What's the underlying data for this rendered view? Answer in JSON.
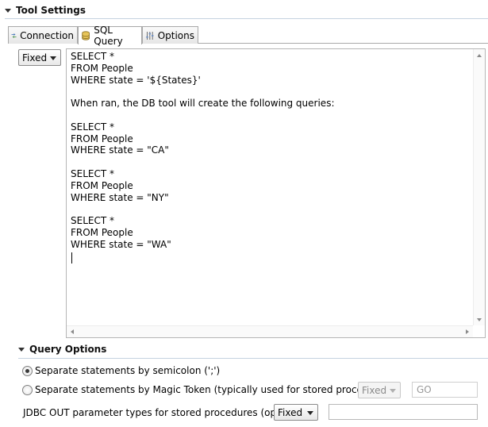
{
  "tool_settings": {
    "title": "Tool Settings"
  },
  "tabs": [
    {
      "label": "Connection",
      "icon": "connection-icon"
    },
    {
      "label": "SQL Query",
      "icon": "database-icon"
    },
    {
      "label": "Options",
      "icon": "options-icon"
    }
  ],
  "active_tab": "SQL Query",
  "query_mode": {
    "value": "Fixed"
  },
  "editor": {
    "text": "SELECT *\nFROM People\nWHERE state = '${States}'\n\nWhen ran, the DB tool will create the following queries:\n\nSELECT *\nFROM People\nWHERE state = \"CA\"\n\nSELECT *\nFROM People\nWHERE state = \"NY\"\n\nSELECT *\nFROM People\nWHERE state = \"WA\"\n"
  },
  "query_options": {
    "title": "Query Options",
    "separate_semicolon": {
      "label": "Separate statements by semicolon (';')",
      "checked": true
    },
    "separate_magic_token": {
      "label": "Separate statements by Magic Token (typically used for stored procedures):",
      "checked": false,
      "mode_value": "Fixed",
      "token_value": "GO"
    },
    "jdbc_out": {
      "label": "JDBC OUT parameter types for stored procedures (optional):",
      "mode_value": "Fixed",
      "value": ""
    }
  }
}
